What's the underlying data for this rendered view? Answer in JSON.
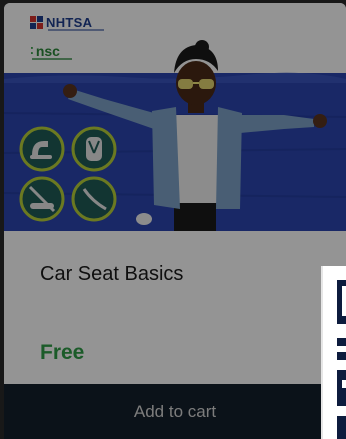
{
  "card": {
    "title": "Car Seat Basics",
    "price": "Free",
    "cta_label": "Add to cart"
  },
  "logos": {
    "nhtsa": "NHTSA",
    "nsc": "nsc"
  },
  "hero_icons": [
    "rear-facing-seat-icon",
    "harness-seat-icon",
    "booster-seat-icon",
    "seat-belt-icon"
  ],
  "colors": {
    "wall": "#2b45b0",
    "price": "#2f9e48",
    "cta_background": "#14202b",
    "icon_ring": "#b8d03a",
    "icon_fill": "#1f5c57"
  }
}
